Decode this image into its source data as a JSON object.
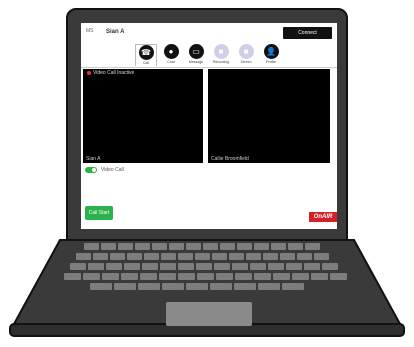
{
  "topbar": {
    "avatar": "MS",
    "name": "Sian A",
    "connect_label": "Connect"
  },
  "toolbar": {
    "tools": [
      {
        "label": "Call",
        "icon": "phone-icon",
        "active": true
      },
      {
        "label": "Chat",
        "icon": "chat-icon"
      },
      {
        "label": "Message",
        "icon": "message-icon"
      },
      {
        "label": "Recording",
        "icon": "record-icon"
      },
      {
        "label": "Screen",
        "icon": "screen-icon"
      },
      {
        "label": "Profile",
        "icon": "user-icon"
      }
    ]
  },
  "video": {
    "left_title": "Video Call Inactive",
    "left_name": "Sian A",
    "right_name": "Callie Broomfield"
  },
  "toggle": {
    "label": "Video Call",
    "on": true
  },
  "call_start_label": "Call Start",
  "onair_label": "OnAIR",
  "colors": {
    "accent_green": "#2bb34b",
    "onair_red": "#d42027",
    "dark": "#111111"
  }
}
